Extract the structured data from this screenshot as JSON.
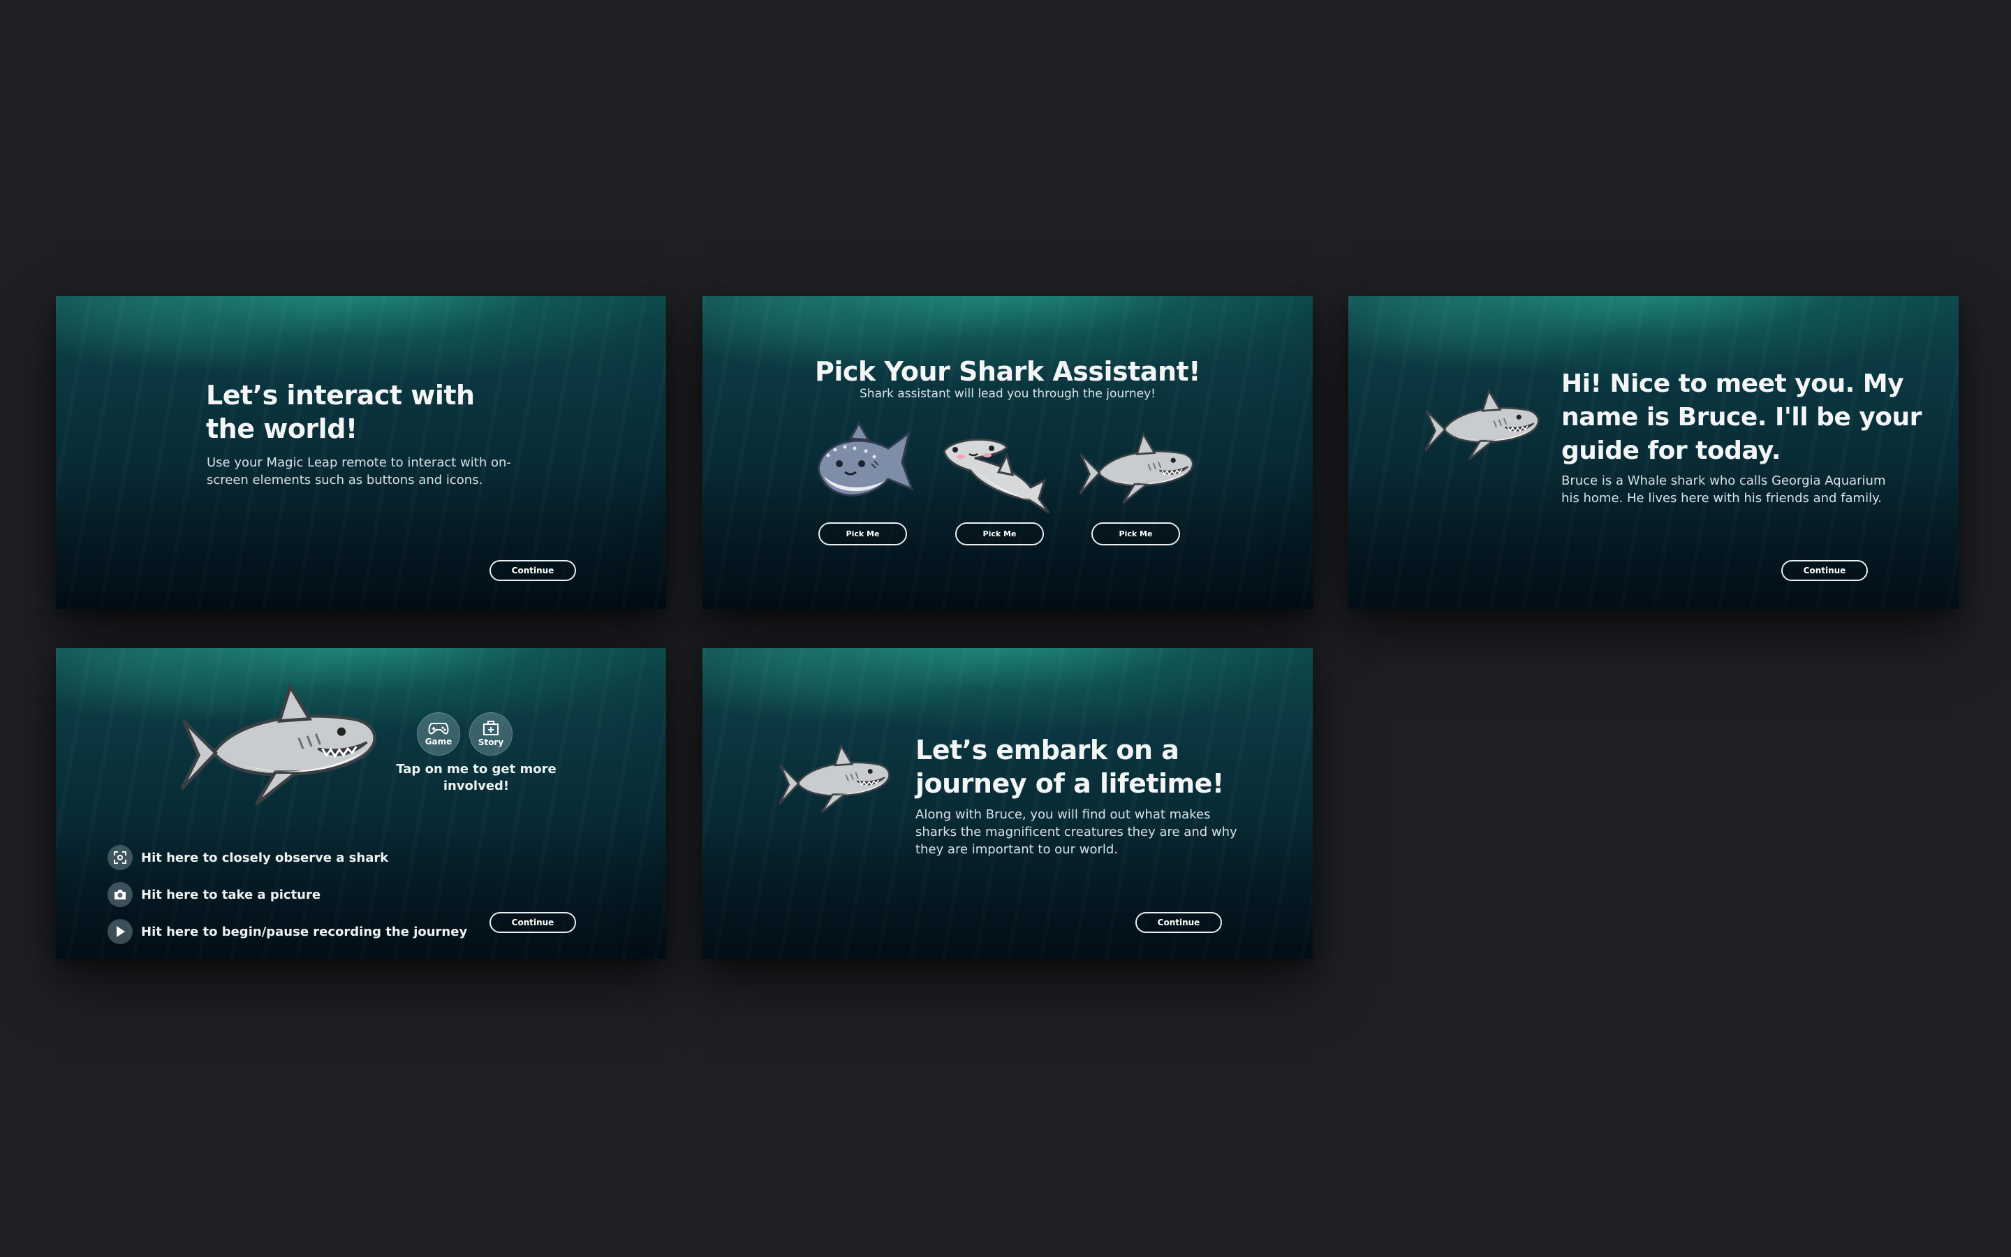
{
  "panel_1": {
    "title": "Let’s interact with the world!",
    "body": "Use your Magic Leap remote to interact with on-screen elements such as buttons and icons.",
    "continue_label": "Continue"
  },
  "panel_2": {
    "title": "Pick Your Shark Assistant!",
    "subtitle": "Shark assistant will lead you through the journey!",
    "pick_labels": [
      "Pick Me",
      "Pick Me",
      "Pick Me"
    ]
  },
  "panel_3": {
    "title": "Hi! Nice to meet you. My name is Bruce.  I'll be your guide for today.",
    "body": "Bruce is a Whale shark who calls Georgia Aquarium his home. He lives here with his friends and family.",
    "continue_label": "Continue"
  },
  "panel_4": {
    "modes": {
      "game": "Game",
      "story": "Story"
    },
    "tap_text": "Tap on me to get more involved!",
    "actions": [
      {
        "icon": "focus-icon",
        "label": "Hit here to closely observe a shark"
      },
      {
        "icon": "camera-icon",
        "label": "Hit here to take a picture"
      },
      {
        "icon": "play-icon",
        "label": "Hit here to begin/pause recording the journey"
      }
    ],
    "continue_label": "Continue"
  },
  "panel_5": {
    "title": "Let’s embark on a journey of a lifetime!",
    "body": "Along with Bruce, you will find out what makes sharks the magnificent creatures they are and why they are important to our world.",
    "continue_label": "Continue"
  },
  "colors": {
    "page_background": "#1f2024",
    "ocean_top": "#0e4a4a",
    "ocean_bottom": "#04121c",
    "shark_body": "#c7cacc",
    "whale_shark_body": "#7f8ea8"
  }
}
